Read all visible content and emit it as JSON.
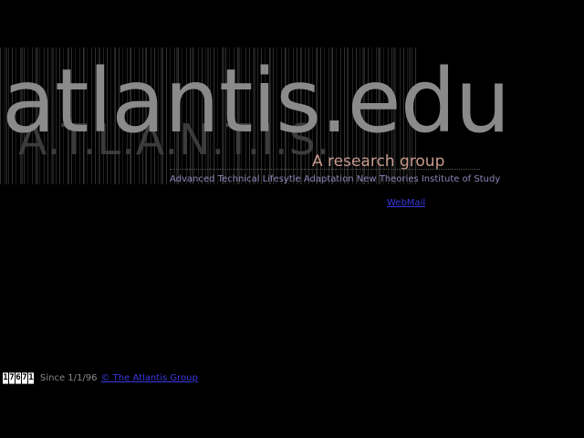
{
  "header": {
    "title": "atlantis.edu",
    "acronym": "A.T.L.A.N.T.I.S.",
    "tagline": "A research group",
    "full_name": "Advanced Technical Lifesytle Adaptation New Theories Institute of Study"
  },
  "links": {
    "webmail": "WebMail"
  },
  "footer": {
    "counter_digits": [
      "1",
      "7",
      "6",
      "7",
      "1"
    ],
    "since": "Since 1/1/96",
    "copyright": "© The Atlantis Group"
  },
  "colors": {
    "background": "#000000",
    "title": "#8a8a8a",
    "acronym": "#3c3c3c",
    "tagline": "#c89a8c",
    "full_name": "#8d86b8",
    "link": "#3a3ae0"
  }
}
